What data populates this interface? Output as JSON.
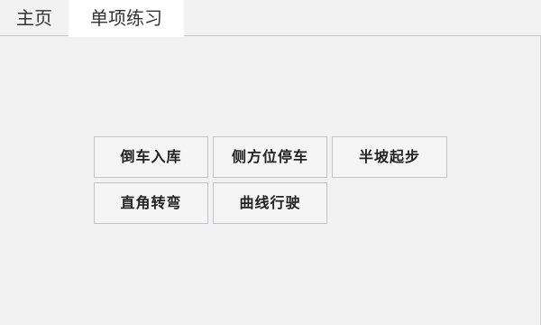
{
  "tabs": {
    "home": "主页",
    "practice": "单项练习"
  },
  "practice_items": {
    "reverse_parking": "倒车入库",
    "side_parking": "侧方位停车",
    "hill_start": "半坡起步",
    "right_angle_turn": "直角转弯",
    "curve_driving": "曲线行驶"
  },
  "colors": {
    "background": "#f2f2f3",
    "active_tab": "#ffffff",
    "button_border": "#c3c3c5"
  }
}
